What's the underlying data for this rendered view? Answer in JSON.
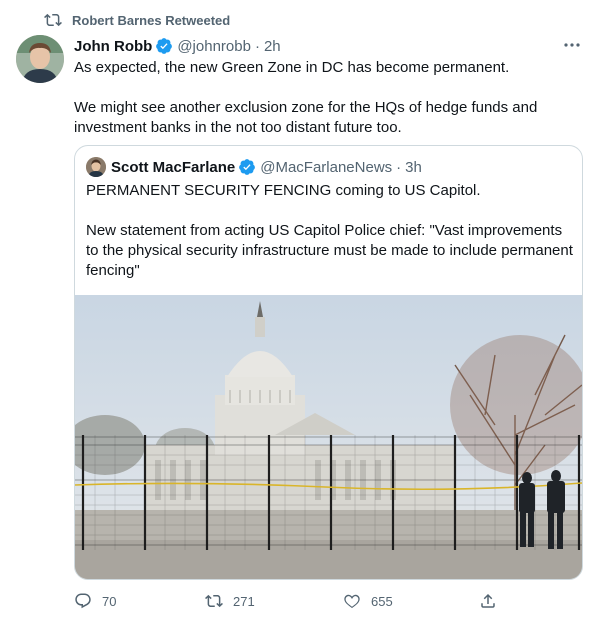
{
  "retweet": {
    "text": "Robert Barnes Retweeted"
  },
  "tweet": {
    "author_name": "John Robb",
    "handle": "@johnrobb",
    "separator": "·",
    "time": "2h",
    "text_line1": "As expected, the new Green Zone in DC has become permanent.",
    "text_line2": "We might see another exclusion zone for the HQs of hedge funds and investment banks in the not too distant future too."
  },
  "quote": {
    "author_name": "Scott MacFarlane",
    "handle": "@MacFarlaneNews",
    "separator": "·",
    "time": "3h",
    "text_line1": "PERMANENT SECURITY FENCING coming to US Capitol.",
    "text_line2": "New statement from acting US Capitol Police chief: \"Vast improvements to the physical security infrastructure must be made to include permanent fencing\""
  },
  "actions": {
    "reply_count": "70",
    "retweet_count": "271",
    "like_count": "655"
  },
  "colors": {
    "verified": "#1d9bf0",
    "secondary_text": "#536471",
    "border": "#cfd9de"
  },
  "icons": [
    "retweet-icon",
    "verified-badge-icon",
    "more-icon",
    "reply-icon",
    "like-icon",
    "share-icon"
  ]
}
